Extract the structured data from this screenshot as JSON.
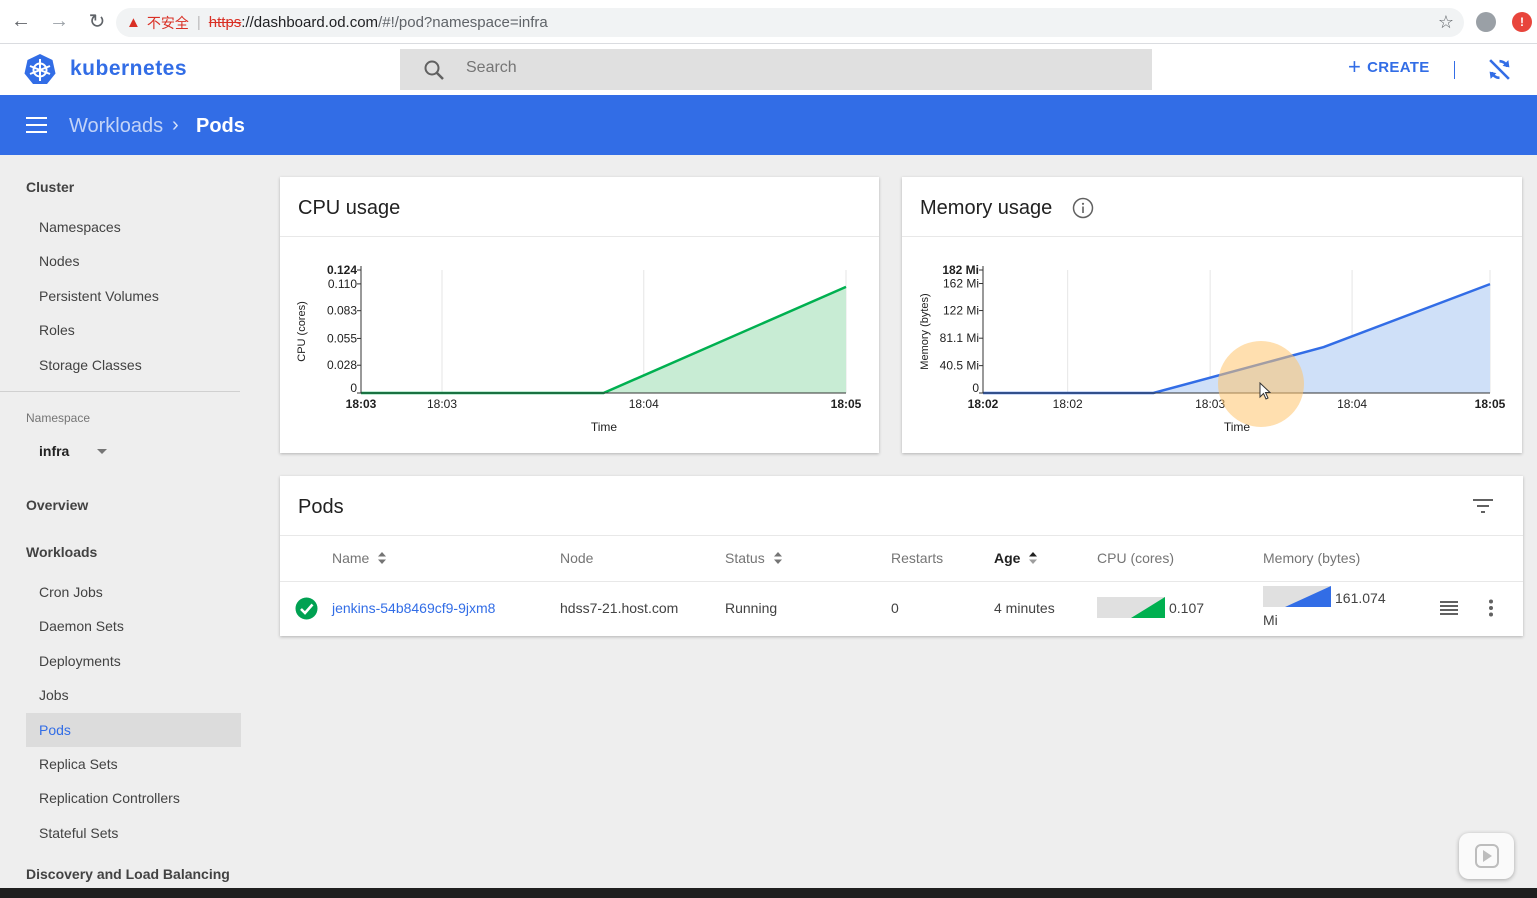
{
  "browser": {
    "insecure_label": "不安全",
    "url_scheme": "https",
    "url_host": "://dashboard.od.com",
    "url_path": "/#!/pod?namespace=infra"
  },
  "header": {
    "brand": "kubernetes",
    "search_placeholder": "Search",
    "create_label": "CREATE"
  },
  "toolbar": {
    "breadcrumb_parent": "Workloads",
    "breadcrumb_current": "Pods"
  },
  "sidebar": {
    "cluster_heading": "Cluster",
    "cluster_items": [
      "Namespaces",
      "Nodes",
      "Persistent Volumes",
      "Roles",
      "Storage Classes"
    ],
    "namespace_label": "Namespace",
    "namespace_value": "infra",
    "overview_heading": "Overview",
    "workloads_heading": "Workloads",
    "workload_items": [
      "Cron Jobs",
      "Daemon Sets",
      "Deployments",
      "Jobs",
      "Pods",
      "Replica Sets",
      "Replication Controllers",
      "Stateful Sets"
    ],
    "active_item": "Pods",
    "discovery_heading": "Discovery and Load Balancing"
  },
  "cpu_card": {
    "title": "CPU usage"
  },
  "memory_card": {
    "title": "Memory usage"
  },
  "chart_data": [
    {
      "type": "area",
      "ylabel": "CPU (cores)",
      "xlabel": "Time",
      "y_ticks": [
        "0",
        "0.028",
        "0.055",
        "0.083",
        "0.110",
        "0.124"
      ],
      "y_tick_values": [
        0,
        0.028,
        0.055,
        0.083,
        0.11,
        0.124
      ],
      "x_ticks": [
        "18:03",
        "18:03",
        "18:04",
        "18:05"
      ],
      "x_tick_pos": [
        0,
        0.167,
        0.583,
        1
      ],
      "x_tick_bold": [
        true,
        false,
        false,
        true
      ],
      "ylim": [
        0,
        0.124
      ],
      "points": [
        [
          0,
          0
        ],
        [
          0.5,
          0
        ],
        [
          1,
          0.107
        ]
      ],
      "color": "#00b050",
      "fill": "#c8ecd4",
      "grid": true
    },
    {
      "type": "area",
      "ylabel": "Memory (bytes)",
      "xlabel": "Time",
      "y_ticks": [
        "0",
        "40.5 Mi",
        "81.1 Mi",
        "122 Mi",
        "162 Mi",
        "182 Mi"
      ],
      "y_tick_values": [
        0,
        40.5,
        81.1,
        122,
        162,
        182
      ],
      "x_ticks": [
        "18:02",
        "18:02",
        "18:03",
        "18:04",
        "18:05"
      ],
      "x_tick_pos": [
        0,
        0.167,
        0.448,
        0.728,
        1
      ],
      "x_tick_bold": [
        true,
        false,
        false,
        false,
        true
      ],
      "ylim": [
        0,
        182
      ],
      "points": [
        [
          0,
          0
        ],
        [
          0.336,
          0
        ],
        [
          0.672,
          68
        ],
        [
          1,
          161.074
        ]
      ],
      "color": "#326de6",
      "fill": "#cfe0f8",
      "grid": true
    }
  ],
  "pods_card": {
    "title": "Pods",
    "columns": [
      "Name",
      "Node",
      "Status",
      "Restarts",
      "Age",
      "CPU (cores)",
      "Memory (bytes)"
    ],
    "rows": [
      {
        "name": "jenkins-54b8469cf9-9jxm8",
        "node": "hdss7-21.host.com",
        "status": "Running",
        "restarts": "0",
        "age": "4 minutes",
        "cpu": "0.107",
        "memory_value": "161.074",
        "memory_unit": "Mi"
      }
    ]
  },
  "colors": {
    "brand": "#326de6",
    "cpu_line": "#00b050",
    "success": "#00a152"
  }
}
